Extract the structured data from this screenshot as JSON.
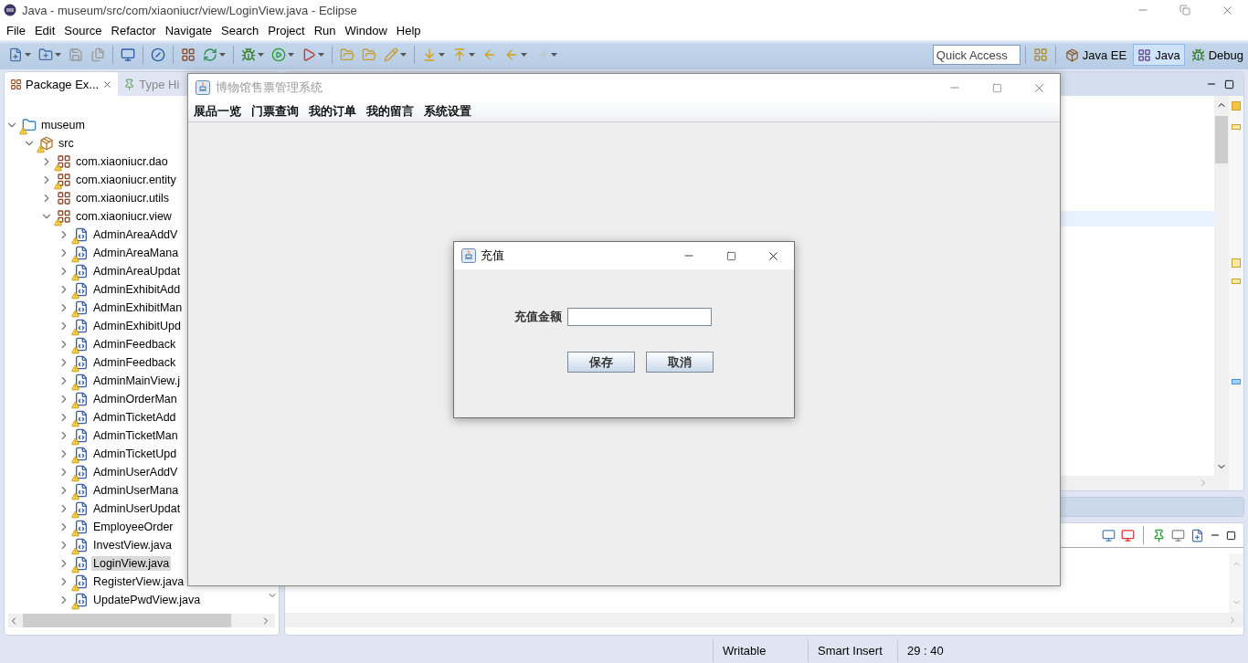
{
  "window": {
    "title": "Java - museum/src/com/xiaoniucr/view/LoginView.java - Eclipse"
  },
  "menu": [
    "File",
    "Edit",
    "Source",
    "Refactor",
    "Navigate",
    "Search",
    "Project",
    "Run",
    "Window",
    "Help"
  ],
  "quick_access": {
    "placeholder": "Quick Access"
  },
  "perspectives": [
    {
      "label": "Java EE",
      "selected": false
    },
    {
      "label": "Java",
      "selected": true
    },
    {
      "label": "Debug",
      "selected": false
    }
  ],
  "left_tabs": [
    {
      "label": "Package Ex...",
      "selected": true,
      "closable": true
    },
    {
      "label": "Type Hi",
      "selected": false,
      "closable": false
    }
  ],
  "tree": [
    {
      "label": "museum",
      "kind": "project",
      "warning": true,
      "expanded": true,
      "selected": false,
      "children": [
        {
          "label": "src",
          "kind": "folder",
          "warning": true,
          "expanded": true,
          "selected": false,
          "children": [
            {
              "label": "com.xiaoniucr.dao",
              "kind": "package",
              "warning": true,
              "expanded": false,
              "selected": false
            },
            {
              "label": "com.xiaoniucr.entity",
              "kind": "package",
              "warning": true,
              "expanded": false,
              "selected": false
            },
            {
              "label": "com.xiaoniucr.utils",
              "kind": "package",
              "warning": false,
              "expanded": false,
              "selected": false
            },
            {
              "label": "com.xiaoniucr.view",
              "kind": "package",
              "warning": true,
              "expanded": true,
              "selected": false,
              "children": [
                {
                  "label": "AdminAreaAddV",
                  "kind": "file",
                  "warning": true,
                  "expanded": false,
                  "selected": false
                },
                {
                  "label": "AdminAreaMana",
                  "kind": "file",
                  "warning": true,
                  "expanded": false,
                  "selected": false
                },
                {
                  "label": "AdminAreaUpdat",
                  "kind": "file",
                  "warning": true,
                  "expanded": false,
                  "selected": false
                },
                {
                  "label": "AdminExhibitAdd",
                  "kind": "file",
                  "warning": true,
                  "expanded": false,
                  "selected": false
                },
                {
                  "label": "AdminExhibitMan",
                  "kind": "file",
                  "warning": true,
                  "expanded": false,
                  "selected": false
                },
                {
                  "label": "AdminExhibitUpd",
                  "kind": "file",
                  "warning": true,
                  "expanded": false,
                  "selected": false
                },
                {
                  "label": "AdminFeedback",
                  "kind": "file",
                  "warning": true,
                  "expanded": false,
                  "selected": false
                },
                {
                  "label": "AdminFeedback",
                  "kind": "file",
                  "warning": true,
                  "expanded": false,
                  "selected": false
                },
                {
                  "label": "AdminMainView.j",
                  "kind": "file",
                  "warning": true,
                  "expanded": false,
                  "selected": false
                },
                {
                  "label": "AdminOrderMan",
                  "kind": "file",
                  "warning": true,
                  "expanded": false,
                  "selected": false
                },
                {
                  "label": "AdminTicketAdd",
                  "kind": "file",
                  "warning": true,
                  "expanded": false,
                  "selected": false
                },
                {
                  "label": "AdminTicketMan",
                  "kind": "file",
                  "warning": true,
                  "expanded": false,
                  "selected": false
                },
                {
                  "label": "AdminTicketUpd",
                  "kind": "file",
                  "warning": true,
                  "expanded": false,
                  "selected": false
                },
                {
                  "label": "AdminUserAddV",
                  "kind": "file",
                  "warning": true,
                  "expanded": false,
                  "selected": false
                },
                {
                  "label": "AdminUserMana",
                  "kind": "file",
                  "warning": true,
                  "expanded": false,
                  "selected": false
                },
                {
                  "label": "AdminUserUpdat",
                  "kind": "file",
                  "warning": true,
                  "expanded": false,
                  "selected": false
                },
                {
                  "label": "EmployeeOrder",
                  "kind": "file",
                  "warning": true,
                  "expanded": false,
                  "selected": false
                },
                {
                  "label": "InvestView.java",
                  "kind": "file",
                  "warning": true,
                  "expanded": false,
                  "selected": false
                },
                {
                  "label": "LoginView.java",
                  "kind": "file",
                  "warning": true,
                  "expanded": false,
                  "selected": true
                },
                {
                  "label": "RegisterView.java",
                  "kind": "file",
                  "warning": true,
                  "expanded": false,
                  "selected": false
                },
                {
                  "label": "UpdatePwdView.java",
                  "kind": "file",
                  "warning": true,
                  "expanded": false,
                  "selected": false
                }
              ]
            }
          ]
        }
      ]
    }
  ],
  "status_bar": [
    "Writable",
    "Smart Insert",
    "29 : 40"
  ],
  "app_window": {
    "title": "博物馆售票管理系统",
    "active": false,
    "menu": [
      "展品一览",
      "门票查询",
      "我的订单",
      "我的留言",
      "系统设置"
    ]
  },
  "dialog": {
    "title": "充值",
    "active": true,
    "field": {
      "label": "充值金额"
    },
    "buttons": [
      "保存",
      "取消"
    ]
  }
}
